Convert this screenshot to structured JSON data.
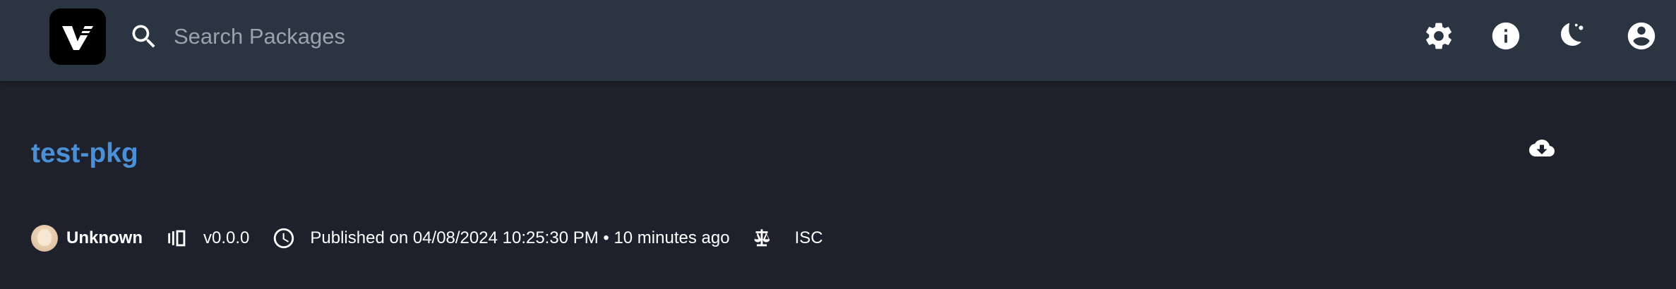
{
  "header": {
    "logo_icon": "verdaccio-logo-icon",
    "search": {
      "placeholder": "Search Packages",
      "value": ""
    },
    "actions": [
      {
        "name": "settings",
        "icon": "gear-icon"
      },
      {
        "name": "info",
        "icon": "info-icon"
      },
      {
        "name": "theme",
        "icon": "moon-icon"
      },
      {
        "name": "account",
        "icon": "account-circle-icon"
      }
    ]
  },
  "package": {
    "name": "test-pkg",
    "author": "Unknown",
    "version": "v0.0.0",
    "published": "Published on 04/08/2024 10:25:30 PM • 10 minutes ago",
    "license": "ISC"
  },
  "colors": {
    "appbar": "#2b3542",
    "background": "#1e212b",
    "accent": "#4a90d9",
    "placeholder": "#9aa3ad"
  }
}
